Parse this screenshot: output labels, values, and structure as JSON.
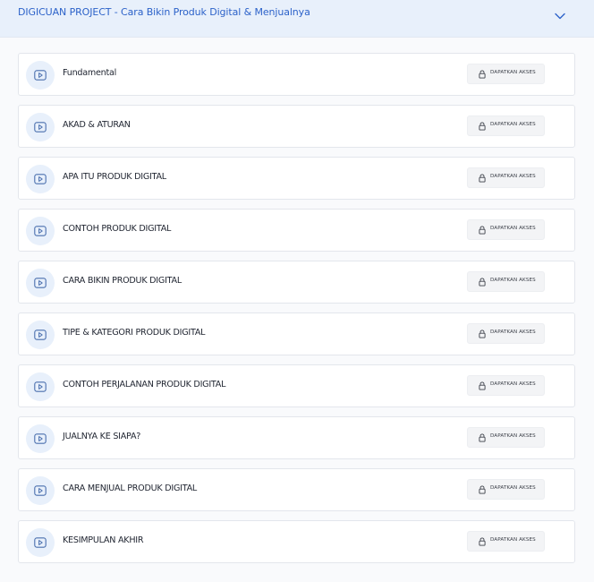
{
  "course": {
    "title": "DIGICUAN PROJECT - Cara Bikin Produk Digital & Menjualnya",
    "toggle_icon": "chevron-down-icon"
  },
  "colors": {
    "accent": "#2c62c9",
    "header_bg": "#e8f0fb",
    "lesson_icon_bg": "#e8f0fb"
  },
  "lessons": [
    {
      "label": "Fundamental",
      "action": "DAPATKAN AKSES",
      "icon": "video-play-icon",
      "action_icon": "lock-icon"
    },
    {
      "label": "AKAD & ATURAN",
      "action": "DAPATKAN AKSES",
      "icon": "video-play-icon",
      "action_icon": "lock-icon"
    },
    {
      "label": "APA ITU PRODUK DIGITAL",
      "action": "DAPATKAN AKSES",
      "icon": "video-play-icon",
      "action_icon": "lock-icon"
    },
    {
      "label": "CONTOH PRODUK DIGITAL",
      "action": "DAPATKAN AKSES",
      "icon": "video-play-icon",
      "action_icon": "lock-icon"
    },
    {
      "label": "CARA BIKIN PRODUK DIGITAL",
      "action": "DAPATKAN AKSES",
      "icon": "video-play-icon",
      "action_icon": "lock-icon"
    },
    {
      "label": "TIPE & KATEGORI PRODUK DIGITAL",
      "action": "DAPATKAN AKSES",
      "icon": "video-play-icon",
      "action_icon": "lock-icon"
    },
    {
      "label": "CONTOH PERJALANAN PRODUK DIGITAL",
      "action": "DAPATKAN AKSES",
      "icon": "video-play-icon",
      "action_icon": "lock-icon"
    },
    {
      "label": "JUALNYA KE SIAPA?",
      "action": "DAPATKAN AKSES",
      "icon": "video-play-icon",
      "action_icon": "lock-icon"
    },
    {
      "label": "CARA MENJUAL PRODUK DIGITAL",
      "action": "DAPATKAN AKSES",
      "icon": "video-play-icon",
      "action_icon": "lock-icon"
    },
    {
      "label": "KESIMPULAN AKHIR",
      "action": "DAPATKAN AKSES",
      "icon": "video-play-icon",
      "action_icon": "lock-icon"
    }
  ]
}
